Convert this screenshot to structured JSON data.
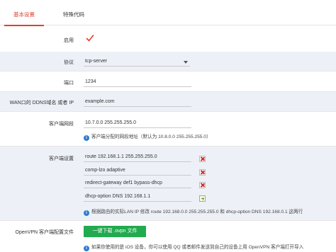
{
  "tabs": {
    "basic": "基本设置",
    "special": "特殊代码"
  },
  "enable": {
    "label": "启用"
  },
  "protocol": {
    "label": "协议",
    "value": "tcp-server"
  },
  "port": {
    "label": "端口",
    "value": "1234"
  },
  "ddns": {
    "label": "WAN口的 DDNS域名 或者 IP",
    "placeholder": "example.com"
  },
  "client_subnet": {
    "label": "客户端网段",
    "value": "10.7.0.0 255.255.255.0",
    "hint": "客户端分配的网段地址（默认为 10.8.0.0 255.255.255.0）"
  },
  "client_settings": {
    "label": "客户端设置",
    "entries": [
      "route 192.168.1.1 255.255.255.0",
      "comp-lzo adaptive",
      "redirect-gateway def1 bypass-dhcp",
      "dhcp-option DNS 192.168.1.1"
    ],
    "hint": "根据路由的实际LAN IP 修改 route 192.168.0.0 255.255.255.0 和 dhcp-option DNS 192.168.0.1 这两行"
  },
  "ovpn": {
    "label": "OpenVPN 客户端配置文件",
    "button": "一键下载 .ovpn 文件",
    "hint": "如果你使用的是 iOS 设备，你可以使用 QQ 或者邮件发送到自己的设备上用 OpenVPN 客户端打开导入"
  },
  "colors": {
    "accent": "#e1402d",
    "button": "#22aa4f",
    "alt_row": "#edf1f7",
    "info": "#2e7ad1"
  }
}
